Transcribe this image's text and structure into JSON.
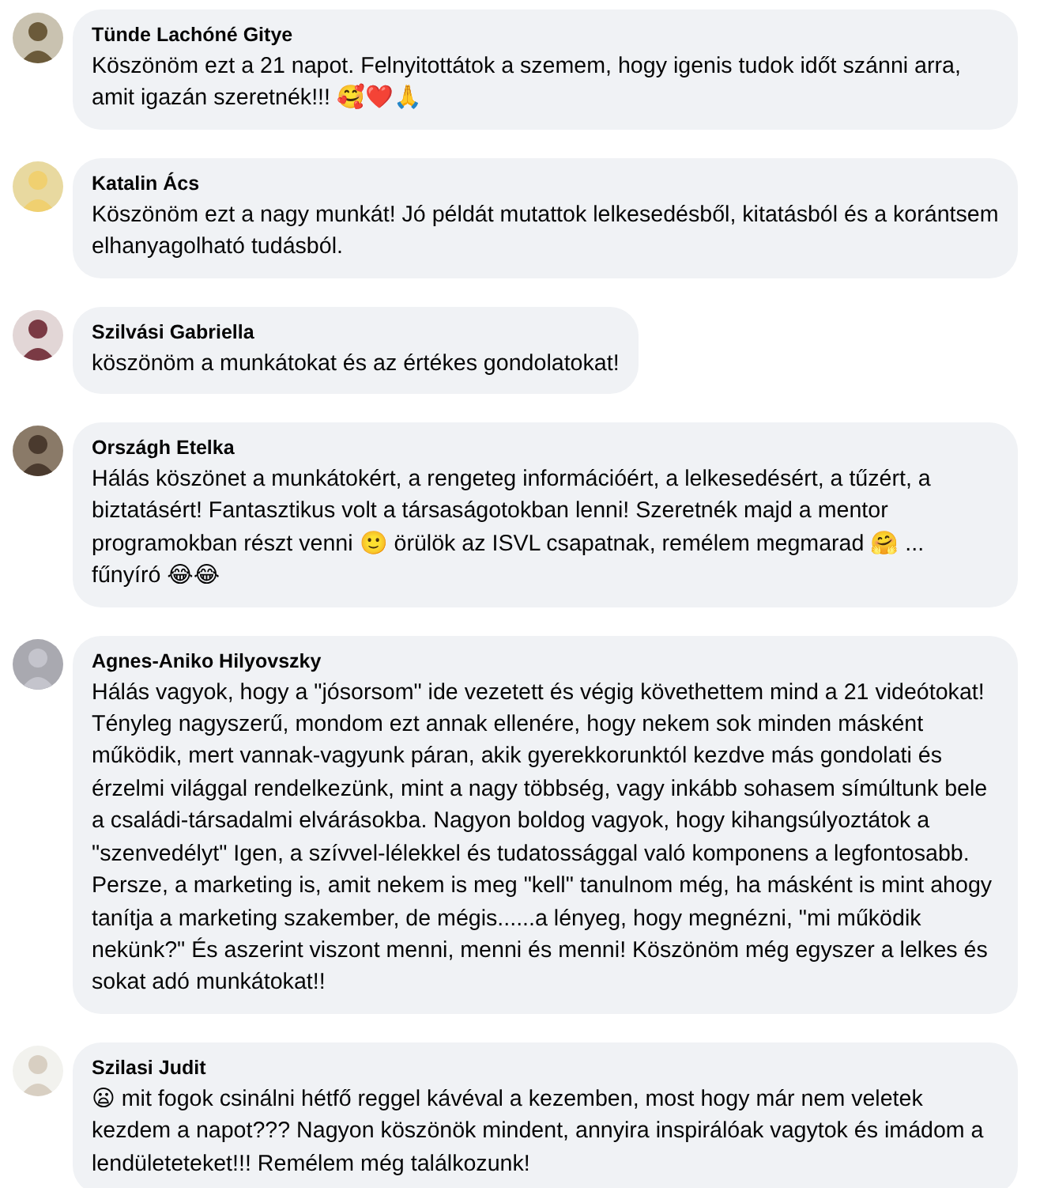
{
  "comments": [
    {
      "author": "Tünde Lachóné Gitye",
      "text": "Köszönöm ezt a 21 napot. Felnyitottátok a szemem, hogy igenis tudok időt szánni arra, amit igazán szeretnék!!! 🥰❤️🙏"
    },
    {
      "author": "Katalin Ács",
      "text": "Köszönöm ezt a nagy munkát! Jó példát mutattok lelkesedésből, kitatásból és a korántsem elhanyagolható tudásból."
    },
    {
      "author": "Szilvási Gabriella",
      "text": "köszönöm a munkátokat és az értékes gondolatokat!"
    },
    {
      "author": "Országh Etelka",
      "text": "Hálás köszönet a munkátokért, a rengeteg információért, a lelkesedésért, a tűzért, a biztatásért! Fantasztikus volt a társaságotokban lenni! Szeretnék majd a mentor programokban részt venni 🙂 örülök az ISVL csapatnak, remélem megmarad 🤗 ... fűnyíró 😂😂"
    },
    {
      "author": "Agnes-Aniko Hilyovszky",
      "text": "Hálás vagyok, hogy a \"jósorsom\" ide vezetett és végig követhettem mind a 21 videótokat! Tényleg nagyszerű, mondom ezt annak ellenére, hogy nekem sok minden másként működik, mert vannak-vagyunk páran, akik gyerekkorunktól kezdve más gondolati és érzelmi világgal rendelkezünk, mint a nagy többség, vagy inkább sohasem símúltunk bele a családi-társadalmi elvárásokba. Nagyon boldog vagyok, hogy kihangsúlyoztátok a \"szenvedélyt\" Igen, a szívvel-lélekkel és tudatossággal való komponens a legfontosabb. Persze, a marketing is, amit nekem is meg \"kell\" tanulnom még, ha másként is mint ahogy tanítja a marketing szakember, de mégis......a lényeg, hogy megnézni, \"mi működik nekünk?\" És aszerint viszont menni, menni és menni! Köszönöm még egyszer a lelkes és sokat adó munkátokat!!"
    },
    {
      "author": "Szilasi Judit",
      "text": "😦 mit fogok csinálni hétfő reggel kávéval a kezemben, most hogy már nem veletek kezdem a napot??? Nagyon köszönök mindent, annyira inspirálóak vagytok és imádom a lendületeteket!!! Remélem még találkozunk!"
    }
  ]
}
